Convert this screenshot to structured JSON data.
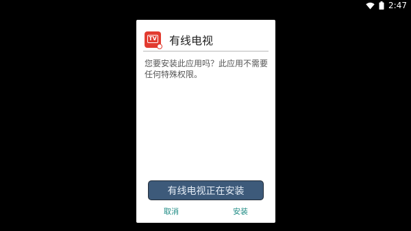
{
  "status_bar": {
    "time": "2:47",
    "icons": [
      "wifi-icon",
      "battery-icon"
    ]
  },
  "dialog": {
    "app_icon_text": "TV",
    "title": "有线电视",
    "message": "您要安装此应用吗？此应用不需要任何特殊权限。",
    "progress_label": "有线电视正在安装",
    "cancel_label": "取消",
    "install_label": "安装"
  },
  "colors": {
    "screen_bg": "#000000",
    "dialog_bg": "#ffffff",
    "icon_red": "#e23b30",
    "progress_button": "#3d5a7a",
    "action_teal": "#1e8b84"
  }
}
